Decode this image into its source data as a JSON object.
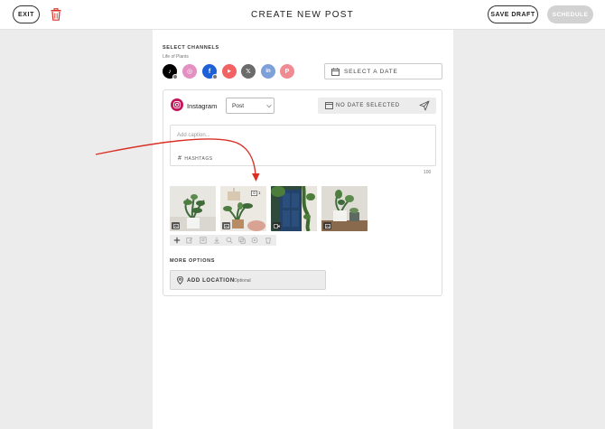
{
  "header": {
    "exit_label": "EXIT",
    "title": "CREATE NEW POST",
    "save_draft_label": "SAVE DRAFT",
    "schedule_label": "SCHEDULE"
  },
  "channels": {
    "section_label": "SELECT CHANNELS",
    "brand": "Life of Plants",
    "items": [
      {
        "name": "tiktok",
        "color": "#000000",
        "glyph": "♪"
      },
      {
        "name": "instagram",
        "color": "#e48fc1",
        "glyph": "◎"
      },
      {
        "name": "facebook",
        "color": "#1e60d6",
        "glyph": "f"
      },
      {
        "name": "youtube",
        "color": "#f26262",
        "glyph": "▶"
      },
      {
        "name": "x",
        "color": "#6b6b6b",
        "glyph": "𝕏"
      },
      {
        "name": "linkedin",
        "color": "#7ea0d8",
        "glyph": "in"
      },
      {
        "name": "pinterest",
        "color": "#f08a93",
        "glyph": "P"
      }
    ]
  },
  "date_picker": {
    "label": "SELECT A DATE"
  },
  "post_card": {
    "network_name": "Instagram",
    "post_type": "Post",
    "date_status": "NO DATE SELECTED",
    "caption_placeholder": "Add caption...",
    "hashtags_label": "HASHTAGS",
    "char_count": "100",
    "alt_count": "1",
    "media": [
      {
        "name": "potted-plant-white",
        "kind": "image"
      },
      {
        "name": "plant-macrame",
        "kind": "image"
      },
      {
        "name": "blue-door-ivy",
        "kind": "video"
      },
      {
        "name": "succulent-pots",
        "kind": "image"
      }
    ],
    "more_options_label": "MORE OPTIONS",
    "location_label": "ADD LOCATION",
    "location_hint": "Optional"
  },
  "colors": {
    "accent_red": "#d93025",
    "instagram": "#c2185b",
    "page_bg": "#ececec"
  }
}
